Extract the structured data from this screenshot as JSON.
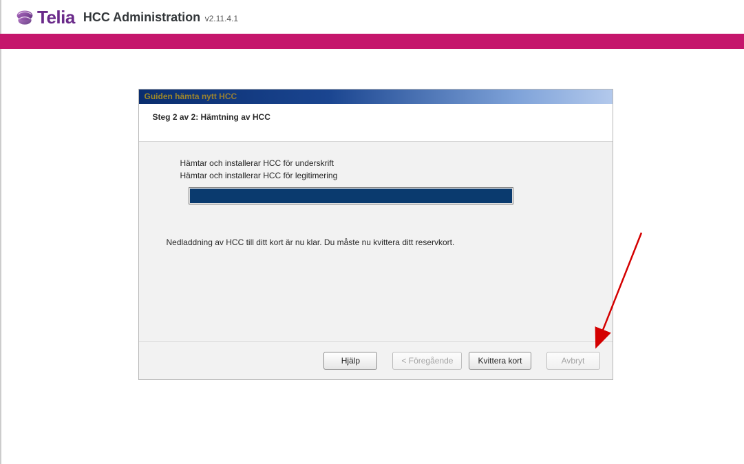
{
  "brand": {
    "name": "Telia"
  },
  "app": {
    "title": "HCC Administration",
    "version": "v2.11.4.1"
  },
  "wizard": {
    "titlebar": "Guiden hämta nytt HCC",
    "step_title": "Steg 2 av 2: Hämtning av HCC",
    "status_line_1": "Hämtar och installerar HCC för underskrift",
    "status_line_2": "Hämtar och installerar HCC för legitimering",
    "progress_percent": 100,
    "completion_message": "Nedladdning av HCC till ditt kort är nu klar. Du måste nu kvittera ditt reservkort."
  },
  "buttons": {
    "help": "Hjälp",
    "previous": "< Föregående",
    "confirm": "Kvittera kort",
    "cancel": "Avbryt"
  },
  "colors": {
    "brand_magenta": "#c5166c",
    "brand_purple": "#6a2a8a",
    "progress_fill": "#0a3a6e"
  }
}
